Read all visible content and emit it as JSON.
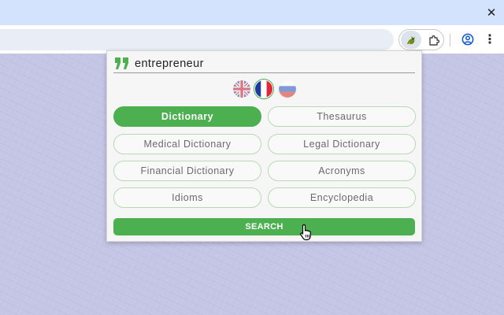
{
  "browser": {
    "close_glyph": "✕",
    "menu_glyph": "⋮"
  },
  "popup": {
    "search": {
      "value": "entrepreneur",
      "placeholder": ""
    },
    "languages": [
      {
        "name": "uk-flag",
        "selected": false
      },
      {
        "name": "france-flag",
        "selected": true
      },
      {
        "name": "russia-flag",
        "selected": false
      }
    ],
    "sources": [
      {
        "label": "Dictionary",
        "active": true
      },
      {
        "label": "Thesaurus",
        "active": false
      },
      {
        "label": "Medical Dictionary",
        "active": false
      },
      {
        "label": "Legal Dictionary",
        "active": false
      },
      {
        "label": "Financial Dictionary",
        "active": false
      },
      {
        "label": "Acronyms",
        "active": false
      },
      {
        "label": "Idioms",
        "active": false
      },
      {
        "label": "Encyclopedia",
        "active": false
      }
    ],
    "search_button_label": "SEARCH"
  },
  "colors": {
    "accent": "#4caf50",
    "page_background": "#c5c6e6",
    "tabstrip": "#d3e3fd"
  }
}
